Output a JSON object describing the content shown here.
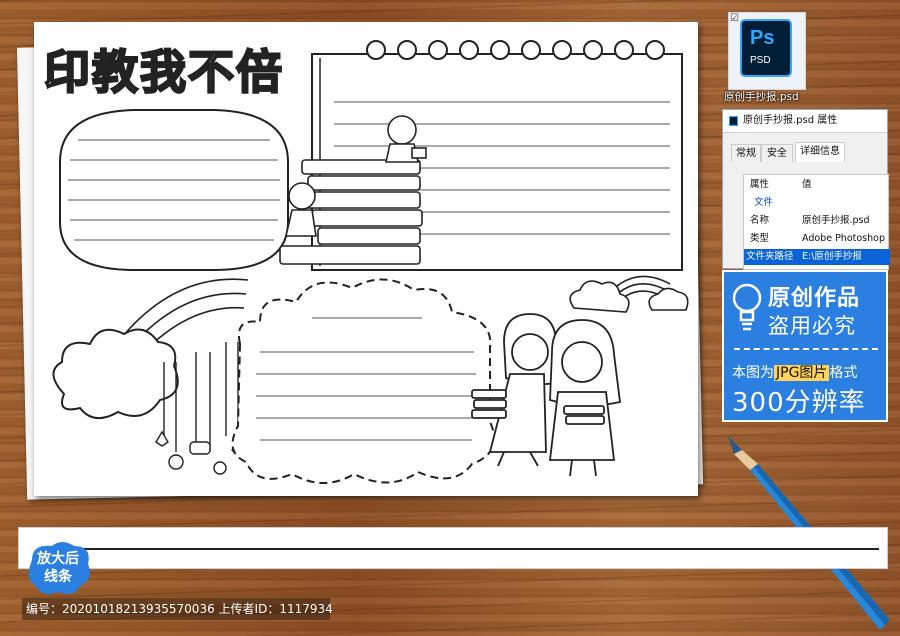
{
  "poster": {
    "title": "印教我不倍"
  },
  "ps_file": {
    "icon_letters": "Ps",
    "icon_ext": "PSD",
    "filename": "原创手抄报.psd"
  },
  "properties_dialog": {
    "title": "原创手抄报.psd 属性",
    "tabs": [
      {
        "label": "常规"
      },
      {
        "label": "安全"
      },
      {
        "label": "详细信息"
      }
    ],
    "header": {
      "name": "属性",
      "value": "值"
    },
    "section": "文件",
    "rows": [
      {
        "name": "名称",
        "value": "原创手抄报.psd"
      },
      {
        "name": "类型",
        "value": "Adobe Photoshop"
      },
      {
        "name": "文件夹路径",
        "value": "E:\\原创手抄报"
      }
    ]
  },
  "promo": {
    "line1": "原创作品",
    "line2": "盗用必究",
    "line3_pre": "本图为",
    "line3_highlight": "JPG图片",
    "line3_post": "格式",
    "line4": "300分辨率"
  },
  "badge": {
    "line1": "放大后",
    "line2": "线条"
  },
  "footer": {
    "id_label": "编号：",
    "id_value": "20201018213935570036",
    "uploader_label": "上传者ID：",
    "uploader_value": "1117934"
  },
  "colors": {
    "accent_blue": "#2a7fe0",
    "highlight": "#ffd25a",
    "ps_dark": "#001e36",
    "ps_blue": "#31a8ff"
  }
}
